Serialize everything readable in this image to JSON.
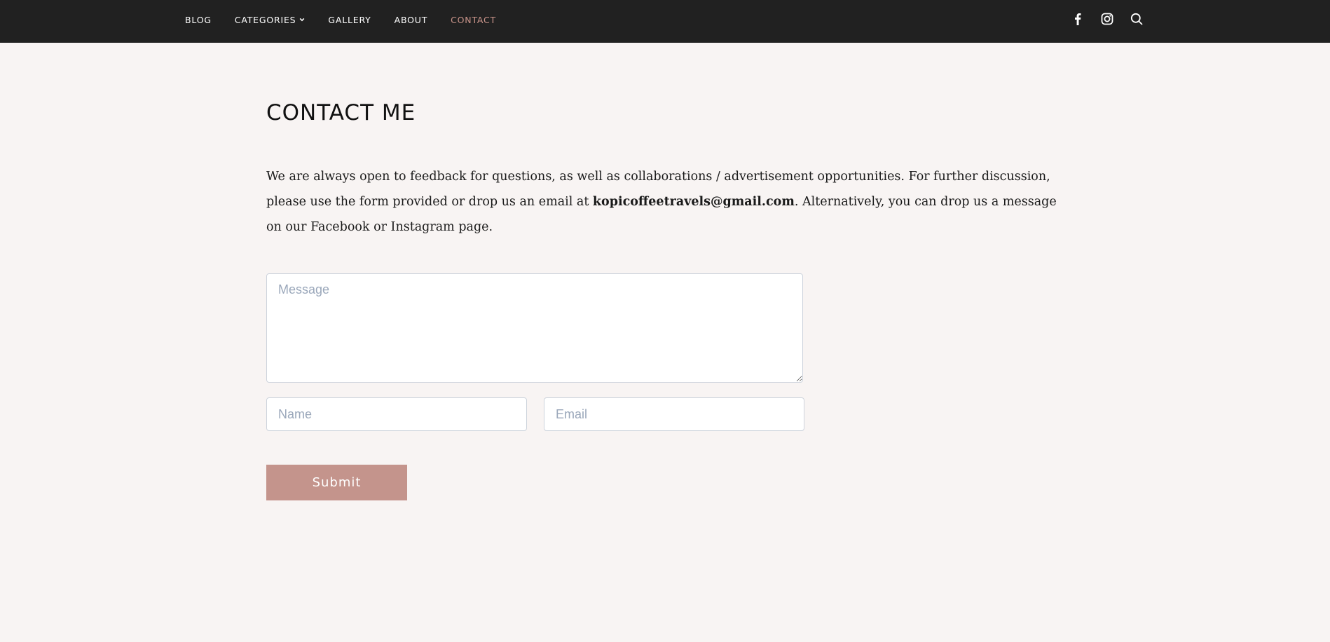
{
  "nav": {
    "items": [
      {
        "label": "BLOG",
        "active": false
      },
      {
        "label": "CATEGORIES",
        "active": false,
        "has_dropdown": true
      },
      {
        "label": "GALLERY",
        "active": false
      },
      {
        "label": "ABOUT",
        "active": false
      },
      {
        "label": "CONTACT",
        "active": true
      }
    ],
    "icons": [
      "facebook-icon",
      "instagram-icon",
      "search-icon"
    ]
  },
  "page": {
    "title": "CONTACT ME",
    "intro_before": "We are always open to feedback for questions, as well as collaborations / advertisement opportunities. For further discussion, please use the form provided or drop us an email at ",
    "email": "kopicoffeetravels@gmail.com",
    "intro_after": ". Alternatively, you can drop us a message on our Facebook or Instagram page."
  },
  "form": {
    "message_placeholder": "Message",
    "name_placeholder": "Name",
    "email_placeholder": "Email",
    "submit_label": "Submit"
  },
  "colors": {
    "topbar": "#212121",
    "background": "#f8f4f3",
    "accent": "#c4948c",
    "active_nav": "#c9948a"
  }
}
